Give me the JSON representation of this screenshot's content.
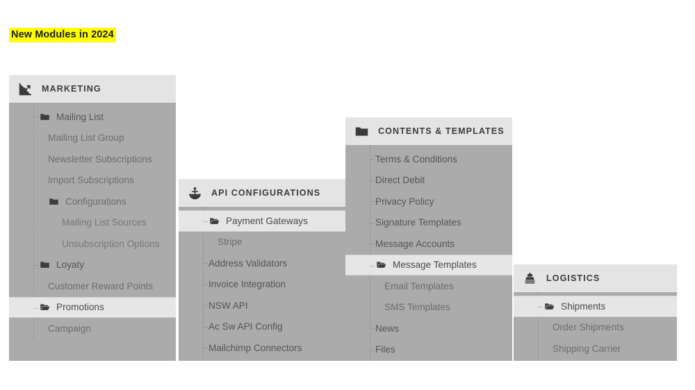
{
  "page": {
    "title": "New Modules in 2024",
    "highlight_color": "#ffff00"
  },
  "colors": {
    "panel_body": "#ababab",
    "panel_header": "#e4e4e4",
    "selected_row": "#e6e6e6",
    "text": "#5f5f5f"
  },
  "panels": [
    {
      "id": "marketing",
      "header": {
        "label": "MARKETING",
        "icon": "chart-line-icon"
      },
      "items": [
        {
          "label": "Mailing List",
          "icon": "folder-icon",
          "level": 1,
          "selected": false
        },
        {
          "label": "Mailing List Group",
          "icon": null,
          "level": 2,
          "selected": false
        },
        {
          "label": "Newsletter Subscriptions",
          "icon": null,
          "level": 2,
          "selected": false
        },
        {
          "label": "Import Subscriptions",
          "icon": null,
          "level": 2,
          "selected": false
        },
        {
          "label": "Configurations",
          "icon": "folder-icon",
          "level": 2,
          "selected": false
        },
        {
          "label": "Mailing List Sources",
          "icon": null,
          "level": 3,
          "selected": false
        },
        {
          "label": "Unsubscription Options",
          "icon": null,
          "level": 3,
          "selected": false
        },
        {
          "label": "Loyaty",
          "icon": "folder-icon",
          "level": 1,
          "selected": false
        },
        {
          "label": "Customer Reward Points",
          "icon": null,
          "level": 2,
          "selected": false
        },
        {
          "label": "Promotions",
          "icon": "folder-open-icon",
          "level": 1,
          "selected": true
        },
        {
          "label": "Campaign",
          "icon": null,
          "level": 2,
          "selected": false
        }
      ]
    },
    {
      "id": "api",
      "header": {
        "label": "API CONFIGURATIONS",
        "icon": "anchor-icon"
      },
      "items": [
        {
          "label": "Payment Gateways",
          "icon": "folder-open-icon",
          "level": 1,
          "selected": true
        },
        {
          "label": "Stripe",
          "icon": null,
          "level": 2,
          "selected": false
        },
        {
          "label": "Address Validators",
          "icon": null,
          "level": 1,
          "selected": false
        },
        {
          "label": "Invoice Integration",
          "icon": null,
          "level": 1,
          "selected": false
        },
        {
          "label": "NSW API",
          "icon": null,
          "level": 1,
          "selected": false
        },
        {
          "label": "Ac Sw API Config",
          "icon": null,
          "level": 1,
          "selected": false
        },
        {
          "label": "Mailchimp Connectors",
          "icon": null,
          "level": 1,
          "selected": false
        }
      ]
    },
    {
      "id": "contents",
      "header": {
        "label": "CONTENTS & TEMPLATES",
        "icon": "folder-icon"
      },
      "items": [
        {
          "label": "Terms & Conditions",
          "icon": null,
          "level": 1,
          "selected": false
        },
        {
          "label": "Direct Debit",
          "icon": null,
          "level": 1,
          "selected": false
        },
        {
          "label": "Privacy Policy",
          "icon": null,
          "level": 1,
          "selected": false
        },
        {
          "label": "Signature Templates",
          "icon": null,
          "level": 1,
          "selected": false
        },
        {
          "label": "Message Accounts",
          "icon": null,
          "level": 1,
          "selected": false
        },
        {
          "label": "Message Templates",
          "icon": "folder-open-icon",
          "level": 1,
          "selected": true
        },
        {
          "label": "Email Templates",
          "icon": null,
          "level": 2,
          "selected": false
        },
        {
          "label": "SMS Templates",
          "icon": null,
          "level": 2,
          "selected": false
        },
        {
          "label": "News",
          "icon": null,
          "level": 1,
          "selected": false
        },
        {
          "label": "Files",
          "icon": null,
          "level": 1,
          "selected": false
        }
      ]
    },
    {
      "id": "logistics",
      "header": {
        "label": "LOGISTICS",
        "icon": "ship-icon"
      },
      "items": [
        {
          "label": "Shipments",
          "icon": "folder-open-icon",
          "level": 1,
          "selected": true
        },
        {
          "label": "Order Shipments",
          "icon": null,
          "level": 2,
          "selected": false
        },
        {
          "label": "Shipping Carrier",
          "icon": null,
          "level": 2,
          "selected": false
        }
      ]
    }
  ]
}
